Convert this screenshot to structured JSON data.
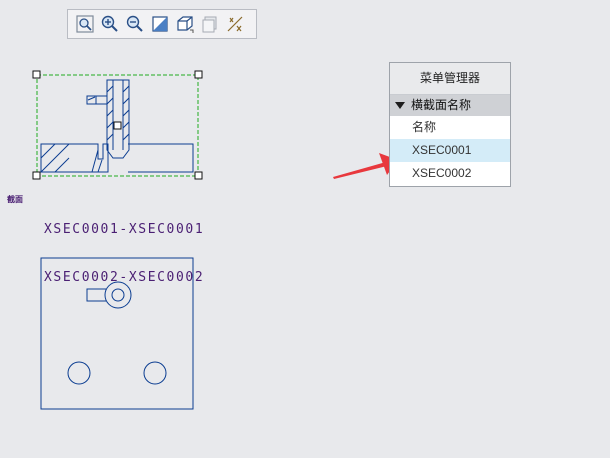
{
  "toolbar": {
    "buttons": [
      {
        "icon": "zoom-fit-icon"
      },
      {
        "icon": "zoom-in-icon"
      },
      {
        "icon": "zoom-out-icon"
      },
      {
        "icon": "repaint-icon"
      },
      {
        "icon": "display-style-icon"
      },
      {
        "icon": "saved-views-icon"
      },
      {
        "icon": "datum-display-icon"
      }
    ]
  },
  "drawing": {
    "section_label": "截面",
    "section_lines": [
      "XSEC0001-XSEC0001",
      "XSEC0002-XSEC0002"
    ],
    "colors": {
      "geometry": "#0b3d91",
      "selection_box": "#1faa1f",
      "annotation": "#4a1f73",
      "arrow": "#e8383d"
    }
  },
  "menu_manager": {
    "title": "菜单管理器",
    "header": "横截面名称",
    "items": [
      {
        "label": "名称"
      },
      {
        "label": "XSEC0001",
        "selected": true
      },
      {
        "label": "XSEC0002"
      }
    ]
  }
}
